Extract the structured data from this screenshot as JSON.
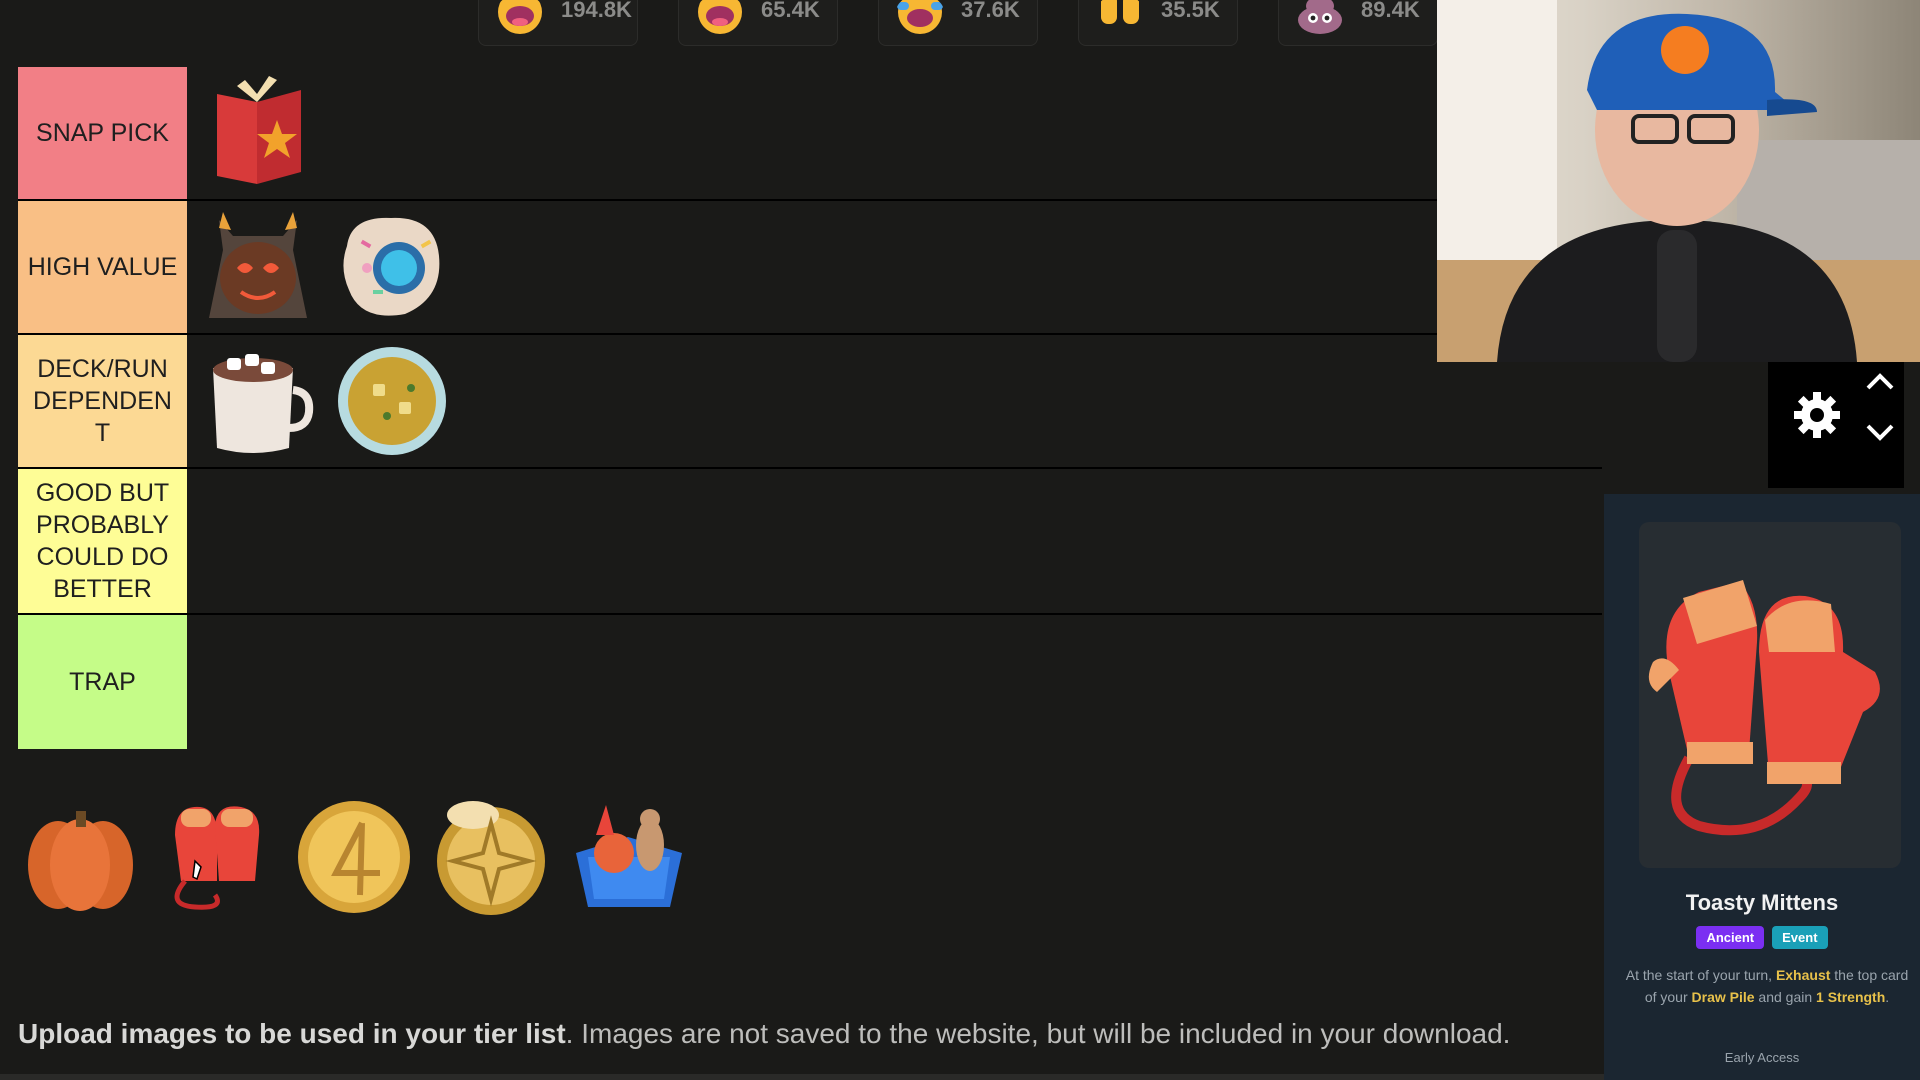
{
  "reactions": [
    {
      "icon": "grinning-face-icon",
      "count": "194.8K",
      "color": "#f7b733"
    },
    {
      "icon": "laughing-face-icon",
      "count": "65.4K",
      "color": "#f7b733"
    },
    {
      "icon": "tears-of-joy-icon",
      "count": "37.6K",
      "color": "#f7b733"
    },
    {
      "icon": "raised-hands-icon",
      "count": "35.5K",
      "color": "#f7b733"
    },
    {
      "icon": "poop-icon",
      "count": "89.4K",
      "color": "#a26a8a"
    }
  ],
  "tiers": [
    {
      "label": "SNAP PICK",
      "color": "#f27f86"
    },
    {
      "label": "HIGH VALUE",
      "color": "#f9bf85"
    },
    {
      "label": "DECK/RUN DEPENDEN T",
      "color": "#fcd994"
    },
    {
      "label": "GOOD BUT PROBABLY COULD DO BETTER",
      "color": "#fefd96"
    },
    {
      "label": "TRAP",
      "color": "#c5fc88"
    }
  ],
  "tier_items": {
    "snap_pick": [
      "star-book-icon"
    ],
    "high_value": [
      "horned-hood-creature-icon",
      "sprinkled-cookie-icon"
    ],
    "deck_run_dependent": [
      "hot-cocoa-mug-icon",
      "soup-bowl-icon"
    ]
  },
  "pool_items": [
    "pumpkin-icon",
    "mittens-icon",
    "gold-coin-icon",
    "compass-coin-icon",
    "toy-box-icon"
  ],
  "upload_note": {
    "bold": "Upload images to be used in your tier list",
    "rest": ". Images are not saved to the website, but will be included in your download."
  },
  "card": {
    "name": "Toasty Mittens",
    "tag1": "Ancient",
    "tag1_color": "#7b2ff2",
    "tag2": "Event",
    "tag2_color": "#1aa0b8",
    "desc_1": "At the start of your turn, ",
    "kw_1": "Exhaust",
    "desc_2": " the top card of your ",
    "kw_2": "Draw Pile",
    "desc_3": " and gain ",
    "kw_3": "1 Strength",
    "desc_4": ".",
    "footer": "Early Access"
  }
}
